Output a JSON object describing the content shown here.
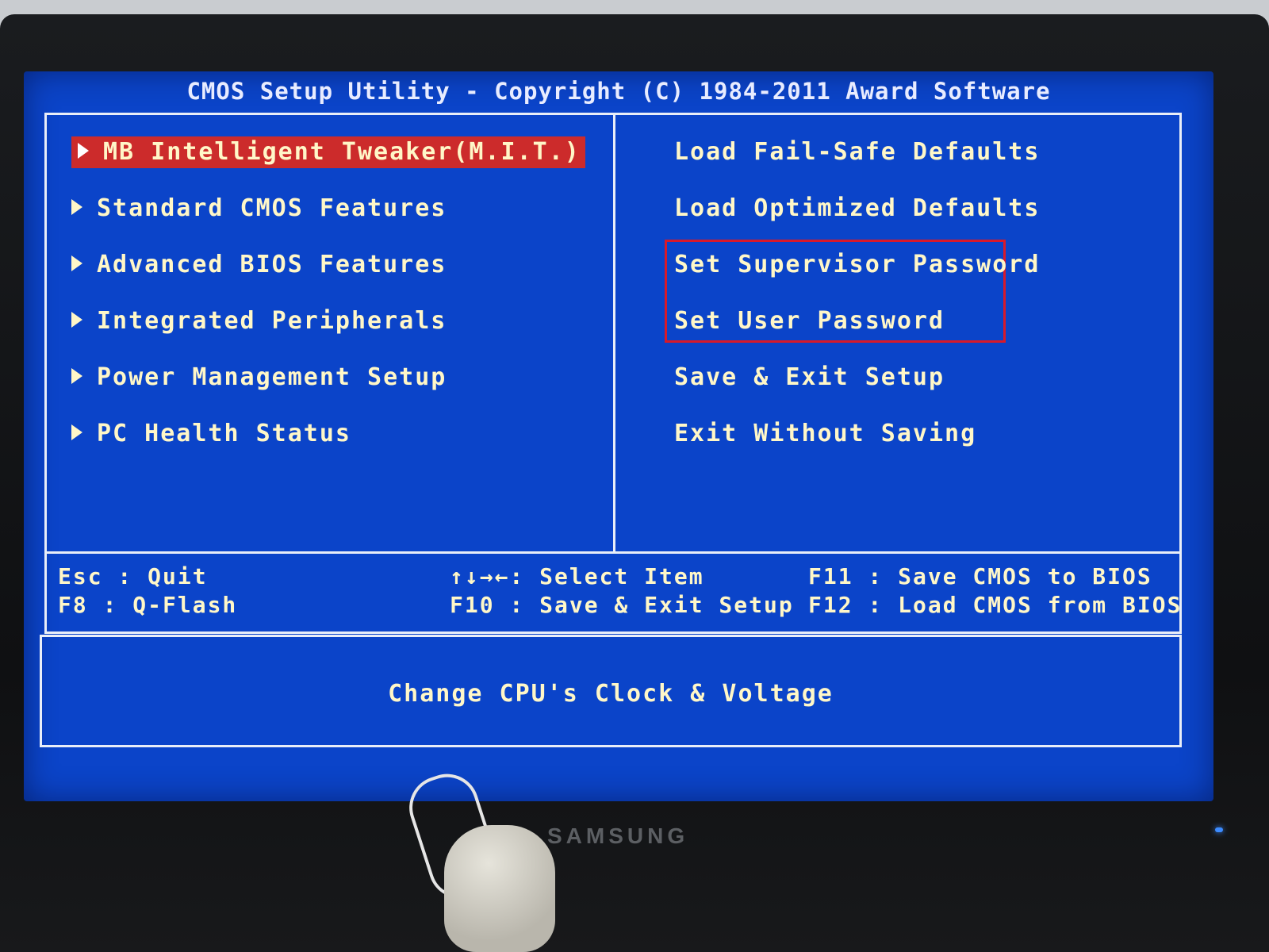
{
  "window": {
    "title": "CMOS Setup Utility - Copyright (C) 1984-2011 Award Software"
  },
  "menu_left": [
    {
      "label": "MB Intelligent Tweaker(M.I.T.)",
      "selected": true
    },
    {
      "label": "Standard CMOS Features"
    },
    {
      "label": "Advanced BIOS Features"
    },
    {
      "label": "Integrated Peripherals"
    },
    {
      "label": "Power Management Setup"
    },
    {
      "label": "PC Health Status"
    }
  ],
  "menu_right": [
    {
      "label": "Load Fail-Safe Defaults"
    },
    {
      "label": "Load Optimized Defaults"
    },
    {
      "label": "Set Supervisor Password"
    },
    {
      "label": "Set User Password"
    },
    {
      "label": "Save & Exit Setup"
    },
    {
      "label": "Exit Without Saving"
    }
  ],
  "key_help": {
    "esc": "Esc  : Quit",
    "f8": "F8   : Q-Flash",
    "arrows": "↑↓→←: Select Item",
    "f10": "F10 : Save & Exit Setup",
    "f11": "F11 : Save CMOS to BIOS",
    "f12": "F12 : Load CMOS from BIOS"
  },
  "help_text": "Change CPU's Clock & Voltage",
  "monitor": {
    "brand": "SAMSUNG"
  },
  "colors": {
    "screen_bg": "#0b44c9",
    "text": "#fff7c8",
    "selection": "#cc2b2b",
    "annotation_box": "#d8192a"
  }
}
